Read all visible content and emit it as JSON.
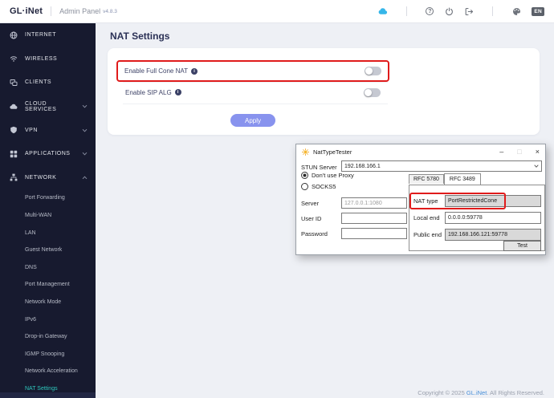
{
  "colors": {
    "accent_teal": "#2ec8be",
    "apply_button": "#8893ee",
    "highlight_red": "#e01b1b",
    "cloud_icon_blue": "#35b6e9",
    "sidebar_bg": "#171a2f"
  },
  "header": {
    "logo": "GL·iNet",
    "product": "Admin Panel",
    "version": "v4.8.3",
    "language_badge": "EN"
  },
  "sidebar": {
    "items": [
      {
        "label": "INTERNET"
      },
      {
        "label": "WIRELESS"
      },
      {
        "label": "CLIENTS"
      },
      {
        "label": "CLOUD SERVICES"
      },
      {
        "label": "VPN"
      },
      {
        "label": "APPLICATIONS"
      },
      {
        "label": "NETWORK"
      }
    ],
    "subitems": [
      {
        "label": "Port Forwarding"
      },
      {
        "label": "Multi-WAN"
      },
      {
        "label": "LAN"
      },
      {
        "label": "Guest Network"
      },
      {
        "label": "DNS"
      },
      {
        "label": "Port Management"
      },
      {
        "label": "Network Mode"
      },
      {
        "label": "IPv6"
      },
      {
        "label": "Drop-in Gateway"
      },
      {
        "label": "IGMP Snooping"
      },
      {
        "label": "Network Acceleration"
      },
      {
        "label": "NAT Settings",
        "active": true
      }
    ]
  },
  "main": {
    "page_title": "NAT Settings",
    "settings": [
      {
        "label": "Enable Full Cone NAT",
        "state": "off",
        "highlighted": true
      },
      {
        "label": "Enable SIP ALG",
        "state": "off",
        "highlighted": false
      }
    ],
    "apply_label": "Apply"
  },
  "nat_tester": {
    "title": "NatTypeTester",
    "controls": {
      "minimize": "–",
      "maximize": "□",
      "close": "×"
    },
    "stun_server": {
      "label": "STUN Server",
      "value": "192.168.166.1"
    },
    "proxy_options": [
      {
        "label": "Don't use Proxy",
        "selected": true
      },
      {
        "label": "SOCKS5",
        "selected": false
      }
    ],
    "fields": [
      {
        "label": "Server",
        "value": "127.0.0.1:1080",
        "disabled": true
      },
      {
        "label": "User ID",
        "value": ""
      },
      {
        "label": "Password",
        "value": ""
      }
    ],
    "tabs": [
      {
        "label": "RFC 5780",
        "active": false
      },
      {
        "label": "RFC 3489",
        "active": true
      }
    ],
    "results": [
      {
        "label": "NAT type",
        "value": "PortRestrictedCone",
        "readonly": true,
        "highlighted": true
      },
      {
        "label": "Local end",
        "value": "0.0.0.0:59778",
        "readonly": false
      },
      {
        "label": "Public end",
        "value": "192.168.166.121:59778",
        "readonly": true
      }
    ],
    "test_button": "Test"
  },
  "footer": {
    "prefix": "Copyright © 2025 ",
    "link": "GL.iNet",
    "suffix": ". All Rights Reserved."
  }
}
